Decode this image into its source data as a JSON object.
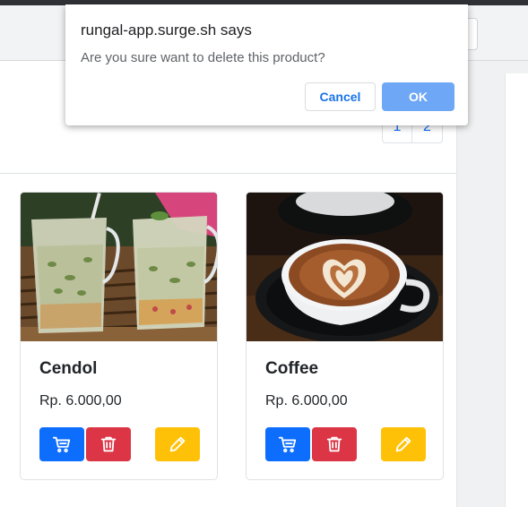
{
  "dialog": {
    "title": "rungal-app.surge.sh says",
    "message": "Are you sure want to delete this product?",
    "cancel_label": "Cancel",
    "ok_label": "OK"
  },
  "pagination": {
    "pages": [
      "1",
      "2"
    ]
  },
  "products": [
    {
      "name": "Cendol",
      "price": "Rp. 6.000,00",
      "image": "cendol-drinks-photo"
    },
    {
      "name": "Coffee",
      "price": "Rp. 6.000,00",
      "image": "latte-art-coffee-photo"
    }
  ],
  "actions": {
    "cart_icon": "cart-icon",
    "delete_icon": "trash-icon",
    "edit_icon": "pencil-icon"
  },
  "colors": {
    "primary": "#0d6efd",
    "danger": "#dc3545",
    "warning": "#ffc107",
    "dialog_ok": "#6ea7f5",
    "dialog_cancel_text": "#1a73e8"
  }
}
